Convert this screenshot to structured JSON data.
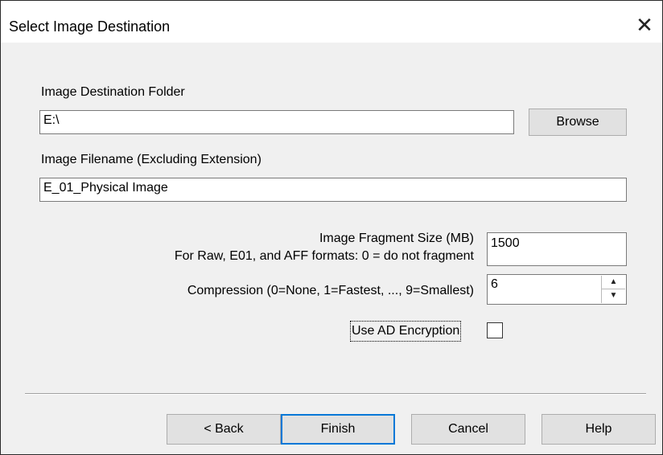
{
  "window": {
    "title": "Select Image Destination"
  },
  "icons": {
    "close": "close-icon",
    "spin_up": "spin-up-icon",
    "spin_down": "spin-down-icon"
  },
  "form": {
    "dest_folder_label": "Image Destination Folder",
    "dest_folder_value": "E:\\",
    "browse_label": "Browse",
    "filename_label": "Image Filename (Excluding Extension)",
    "filename_value": "E_01_Physical Image",
    "fragment_label_line1": "Image Fragment Size (MB)",
    "fragment_label_line2": "For Raw, E01, and AFF formats: 0 = do not fragment",
    "fragment_value": "1500",
    "compression_label": "Compression (0=None, 1=Fastest, ..., 9=Smallest)",
    "compression_value": "6",
    "encryption_label": "Use AD Encryption",
    "encryption_checked": false
  },
  "buttons": {
    "back": "< Back",
    "finish": "Finish",
    "cancel": "Cancel",
    "help": "Help"
  },
  "colors": {
    "dialog_bg": "#f0f0f0",
    "titlebar_bg": "#ffffff",
    "default_button_border": "#0078d7"
  }
}
